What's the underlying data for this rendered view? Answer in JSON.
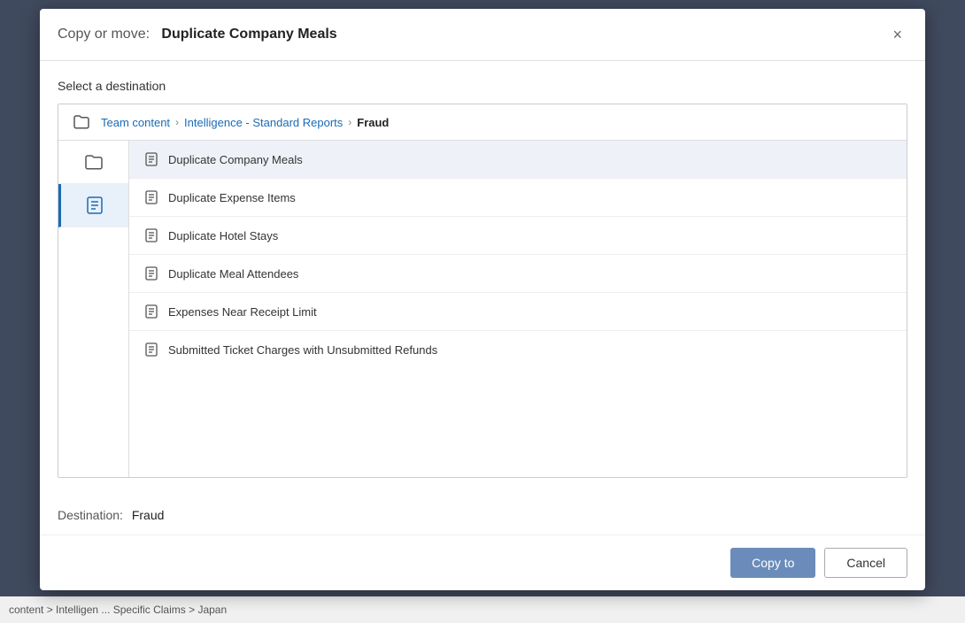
{
  "modal": {
    "title_label": "Copy or move:",
    "title_name": "Duplicate Company Meals",
    "select_destination": "Select a destination",
    "close_label": "×"
  },
  "breadcrumb": {
    "items": [
      {
        "label": "Team content",
        "active": false
      },
      {
        "label": "Intelligence - Standard Reports",
        "active": false
      },
      {
        "label": "Fraud",
        "active": true
      }
    ]
  },
  "file_list": {
    "items": [
      {
        "name": "Duplicate Company Meals",
        "selected": true
      },
      {
        "name": "Duplicate Expense Items",
        "selected": false
      },
      {
        "name": "Duplicate Hotel Stays",
        "selected": false
      },
      {
        "name": "Duplicate Meal Attendees",
        "selected": false
      },
      {
        "name": "Expenses Near Receipt Limit",
        "selected": false
      },
      {
        "name": "Submitted Ticket Charges with Unsubmitted Refunds",
        "selected": false
      }
    ]
  },
  "destination": {
    "label": "Destination:",
    "value": "Fraud"
  },
  "buttons": {
    "copy_label": "Copy to",
    "cancel_label": "Cancel"
  },
  "background": {
    "breadcrumb_text": "content > Intelligen ... Specific Claims > Japan"
  }
}
